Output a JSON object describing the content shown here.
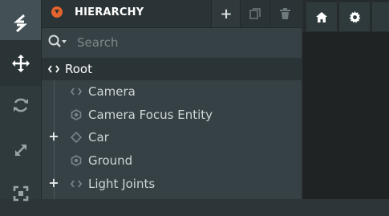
{
  "toolbar": {
    "tools": [
      {
        "name": "logo-icon"
      },
      {
        "name": "move-icon"
      },
      {
        "name": "rotate-icon"
      },
      {
        "name": "scale-icon"
      },
      {
        "name": "resize-icon"
      }
    ]
  },
  "hierarchy": {
    "title": "HIERARCHY",
    "title_icon": "hierarchy-icon",
    "actions": [
      {
        "name": "add-entity-button",
        "icon": "plus-icon"
      },
      {
        "name": "duplicate-entity-button",
        "icon": "duplicate-icon"
      },
      {
        "name": "delete-entity-button",
        "icon": "trash-icon"
      }
    ],
    "search": {
      "placeholder": "Search"
    },
    "items": [
      {
        "label": "Root",
        "icon": "code-icon",
        "selected": true
      },
      {
        "label": "Camera",
        "icon": "code-icon"
      },
      {
        "label": "Camera Focus Entity",
        "icon": "hexagon-icon"
      },
      {
        "label": "Car",
        "icon": "diamond-icon",
        "expandable": true
      },
      {
        "label": "Ground",
        "icon": "hexagon-icon"
      },
      {
        "label": "Light Joints",
        "icon": "code-icon",
        "expandable": true
      }
    ]
  },
  "viewport": {
    "buttons": [
      {
        "name": "home-icon"
      },
      {
        "name": "gear-icon"
      }
    ]
  },
  "colors": {
    "accent": "#e2642c",
    "panel_bg": "#364145",
    "header_bg": "#2a3336"
  }
}
